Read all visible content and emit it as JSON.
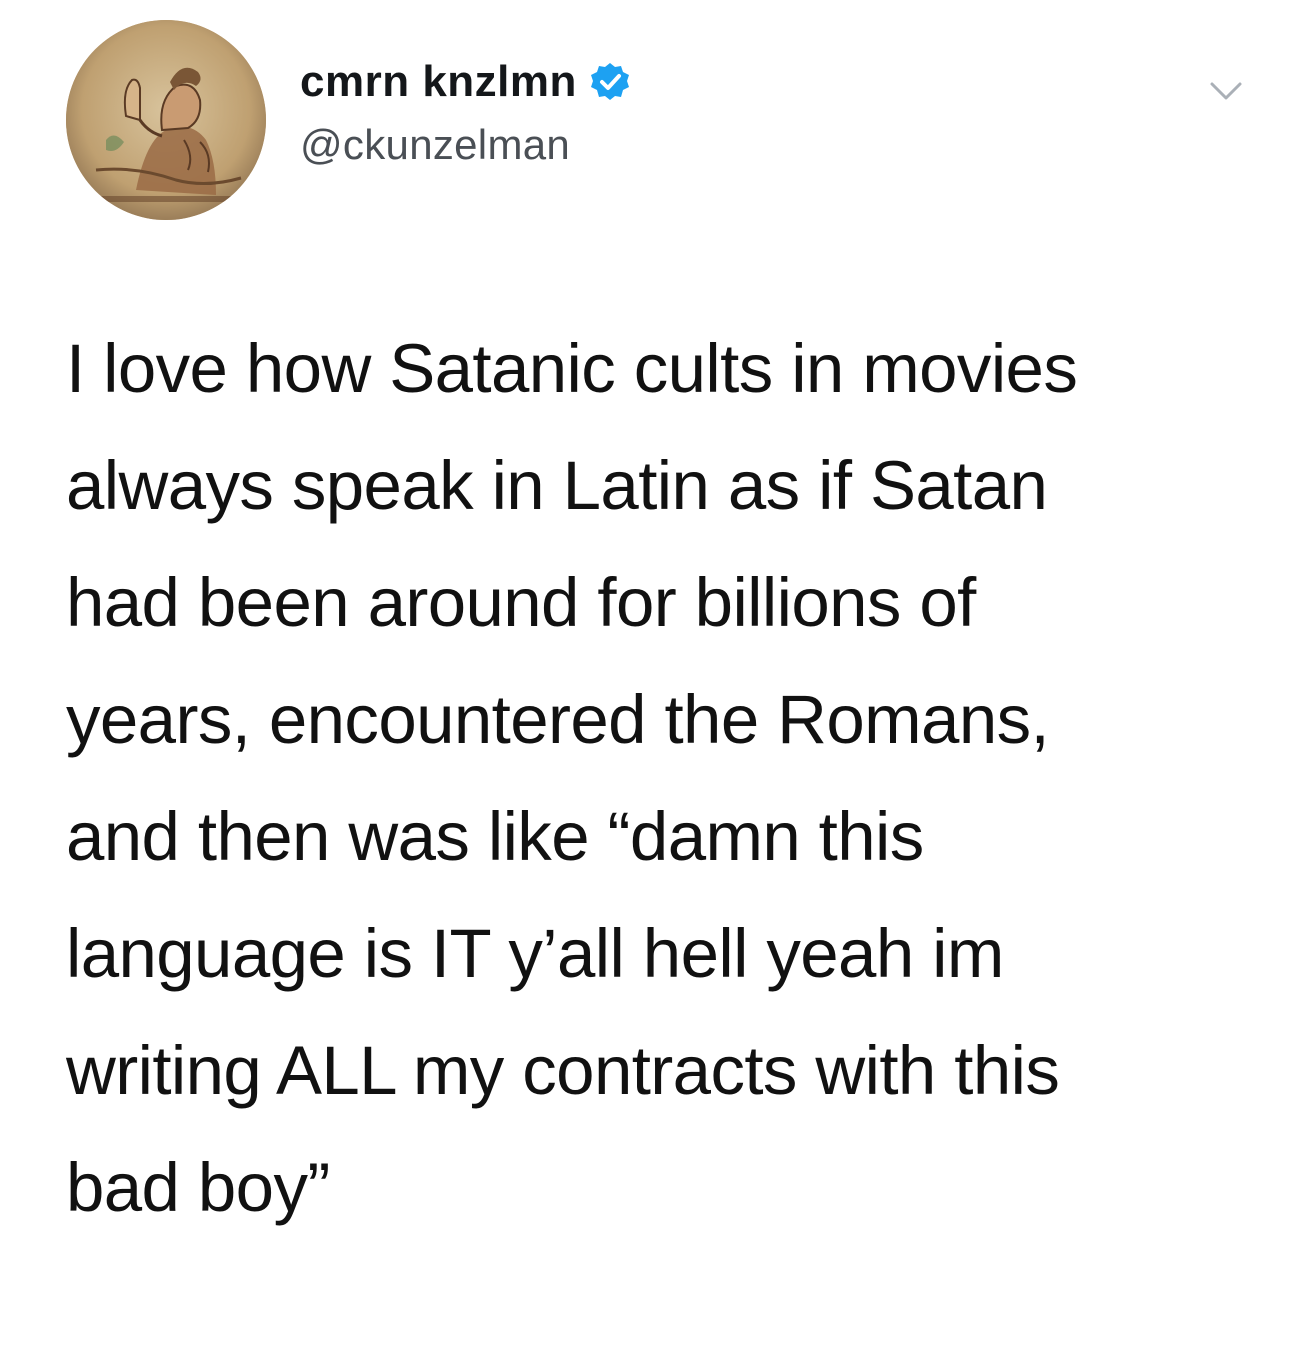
{
  "tweet": {
    "author": {
      "display_name": "cmrn knzlmn",
      "handle": "@ckunzelman",
      "verified": true,
      "verified_icon": "verified-badge-icon",
      "avatar_icon": "avatar-illustration"
    },
    "menu_icon": "chevron-down-icon",
    "text_lines": [
      "I love how Satanic cults in movies",
      "always speak in Latin as if Satan",
      "had been around for billions of",
      "years, encountered the Romans,",
      "and then was like “damn this",
      "language is IT y’all hell yeah im",
      "writing ALL my contracts with this",
      "bad boy”"
    ]
  },
  "colors": {
    "background": "#ffffff",
    "verified_blue": "#1da1f2",
    "text": "#111111",
    "handle_gray": "#4a4f55"
  }
}
